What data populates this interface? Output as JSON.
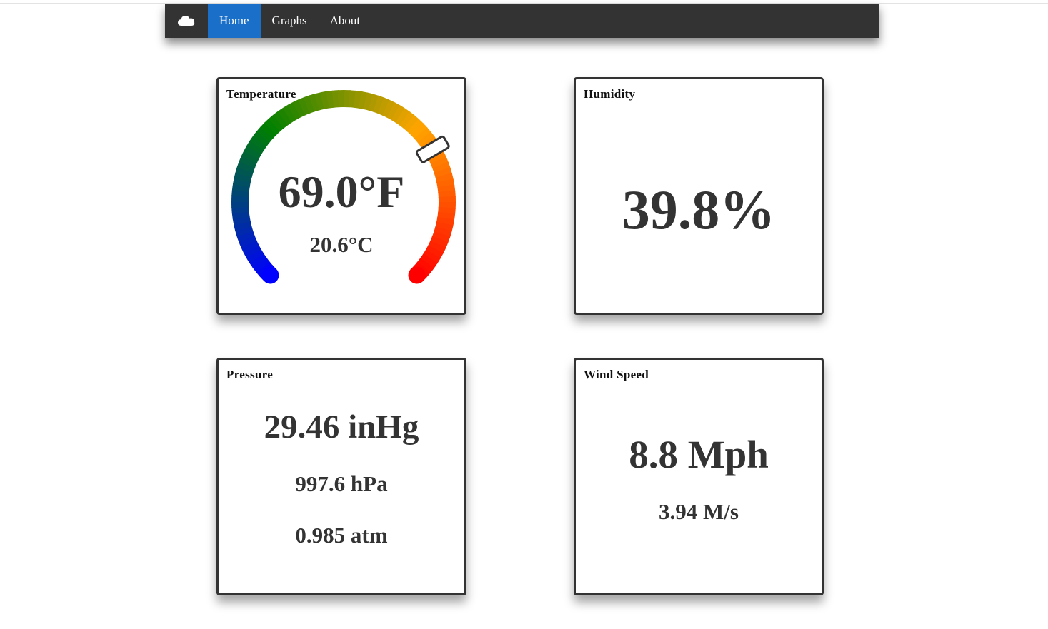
{
  "nav": {
    "brand_icon": "cloud-icon",
    "items": [
      {
        "label": "Home",
        "active": true
      },
      {
        "label": "Graphs",
        "active": false
      },
      {
        "label": "About",
        "active": false
      }
    ],
    "active_color": "#1a6fc9",
    "bar_color": "#333333"
  },
  "temperature": {
    "title": "Temperature",
    "fahrenheit": "69.0°F",
    "celsius": "20.6°C",
    "gauge_level": 0.72,
    "gauge_colors": [
      "#0000ff",
      "#008000",
      "#ffa500",
      "#ff0000"
    ]
  },
  "humidity": {
    "title": "Humidity",
    "value": "39.8%"
  },
  "pressure": {
    "title": "Pressure",
    "inhg": "29.46 inHg",
    "hpa": "997.6 hPa",
    "atm": "0.985 atm"
  },
  "wind": {
    "title": "Wind Speed",
    "mph": "8.8 Mph",
    "ms": "3.94 M/s"
  }
}
